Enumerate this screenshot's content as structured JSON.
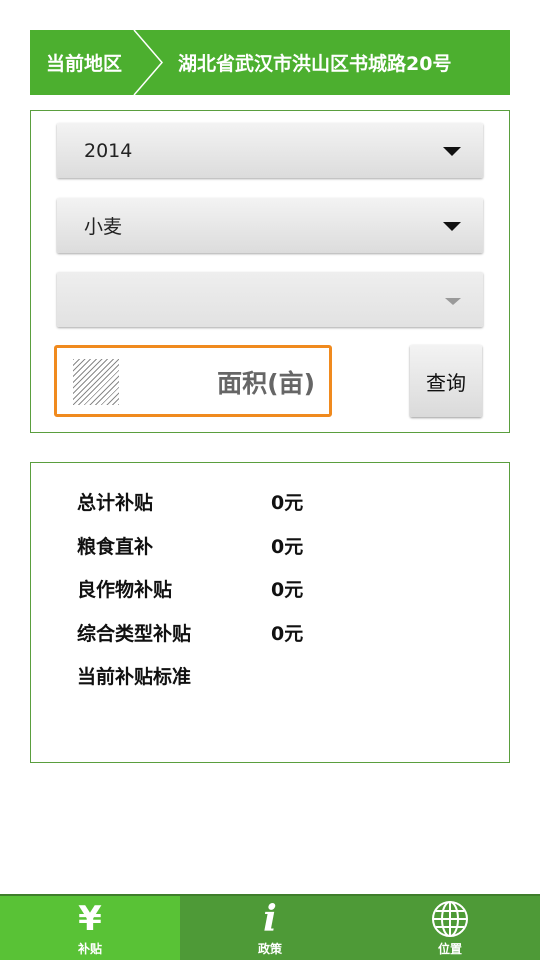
{
  "region": {
    "label": "当前地区",
    "value": "湖北省武汉市洪山区书城路20号"
  },
  "form": {
    "year_select": {
      "value": "2014"
    },
    "crop_select": {
      "value": "小麦"
    },
    "sub_select": {
      "value": ""
    },
    "area_input": {
      "placeholder": "面积(亩)",
      "value": ""
    },
    "query_button": "查询"
  },
  "results": [
    {
      "label": "总计补贴",
      "value": "0元"
    },
    {
      "label": "粮食直补",
      "value": "0元"
    },
    {
      "label": "良作物补贴",
      "value": "0元"
    },
    {
      "label": "综合类型补贴",
      "value": "0元"
    },
    {
      "label": "当前补贴标准",
      "value": ""
    }
  ],
  "bottom_nav": [
    {
      "label": "补贴",
      "icon": "yen-icon",
      "active": true
    },
    {
      "label": "政策",
      "icon": "info-icon",
      "active": false
    },
    {
      "label": "位置",
      "icon": "globe-icon",
      "active": false
    }
  ],
  "colors": {
    "brand_green": "#4caf2f",
    "active_tab": "#59c236",
    "input_focus": "#f08a1e"
  }
}
